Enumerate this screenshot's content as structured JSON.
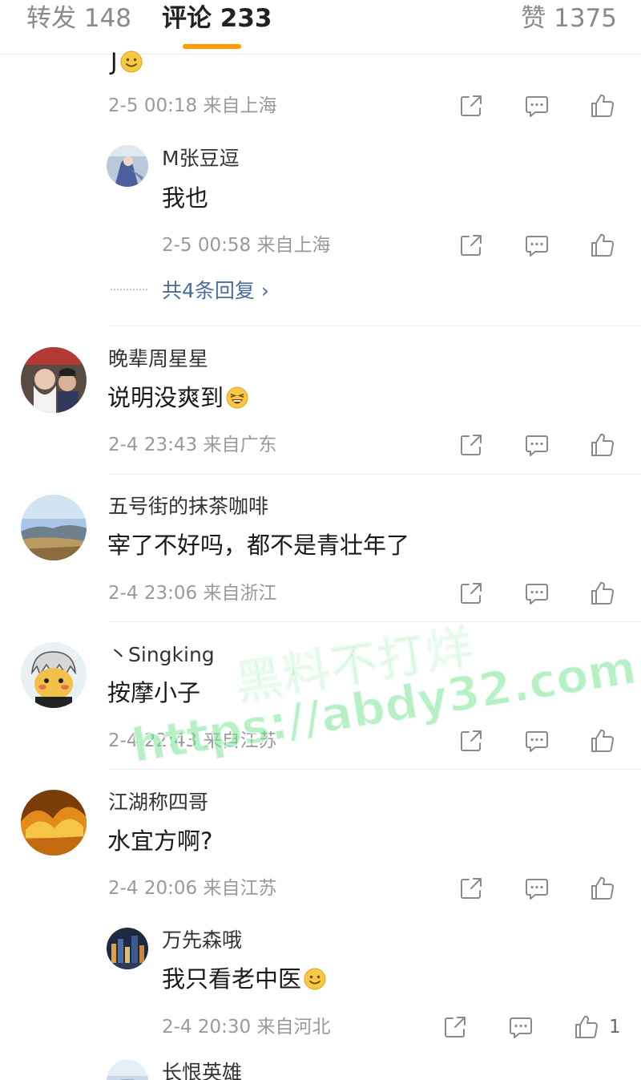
{
  "tabs": {
    "repost": "转发 148",
    "comment": "评论 233",
    "like": "赞 1375"
  },
  "top_fragment": {
    "text": "J",
    "meta": "2-5 00:18  来自上海"
  },
  "reply_1": {
    "username": "M张豆逗",
    "text": "我也",
    "meta": "2-5 00:58  来自上海"
  },
  "more_replies": "共4条回复 ›",
  "comments": [
    {
      "username": "晚辈周星星",
      "text": "说明没爽到",
      "emoji": "laughing-face-icon",
      "meta": "2-4 23:43  来自广东"
    },
    {
      "username": "五号街的抹茶咖啡",
      "text": "宰了不好吗，都不是青壮年了",
      "meta": "2-4 23:06  来自浙江"
    },
    {
      "username": "丶Singking",
      "text": "按摩小子",
      "meta": "2-4 22:43  来自江苏"
    },
    {
      "username": "江湖称四哥",
      "text": "水宜方啊?",
      "meta": "2-4 20:06  来自江苏"
    }
  ],
  "reply_2": {
    "username": "万先森哦",
    "text": "我只看老中医",
    "emoji": "smile-face-icon",
    "meta": "2-4 20:30  来自河北",
    "like_count": "1"
  },
  "last_reply": {
    "username": "长恨英雄"
  },
  "watermark": {
    "line1": "黑料不打烊",
    "line2": "https://abdy32.com"
  },
  "colors": {
    "accent": "#ff9a00",
    "link": "#4a6c9b",
    "meta": "#9a9a9a"
  }
}
